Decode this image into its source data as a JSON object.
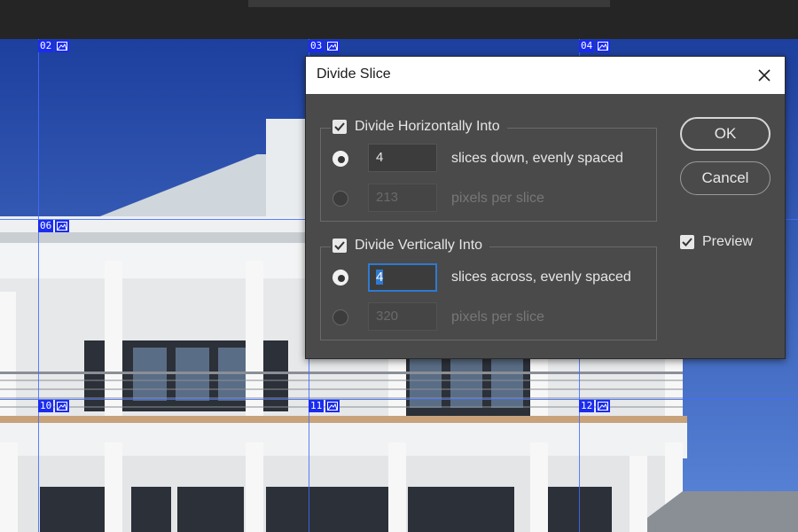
{
  "dialog": {
    "title": "Divide Slice",
    "horizontal": {
      "label": "Divide Horizontally Into",
      "checked": true,
      "slices_value": "4",
      "slices_label": "slices down, evenly spaced",
      "pixels_value": "213",
      "pixels_label": "pixels per slice"
    },
    "vertical": {
      "label": "Divide Vertically Into",
      "checked": true,
      "slices_value": "4",
      "slices_label": "slices across, evenly spaced",
      "pixels_value": "320",
      "pixels_label": "pixels per slice"
    },
    "ok_label": "OK",
    "cancel_label": "Cancel",
    "preview_label": "Preview",
    "preview_checked": true
  },
  "slices": {
    "s02": "02",
    "s03": "03",
    "s04": "04",
    "s06": "06",
    "s10": "10",
    "s11": "11",
    "s12": "12"
  },
  "colors": {
    "slice_line": "#3f6cff",
    "slice_badge": "#1a2cf0",
    "dialog_bg": "#4a4a4a",
    "focus": "#2e7ad1"
  }
}
